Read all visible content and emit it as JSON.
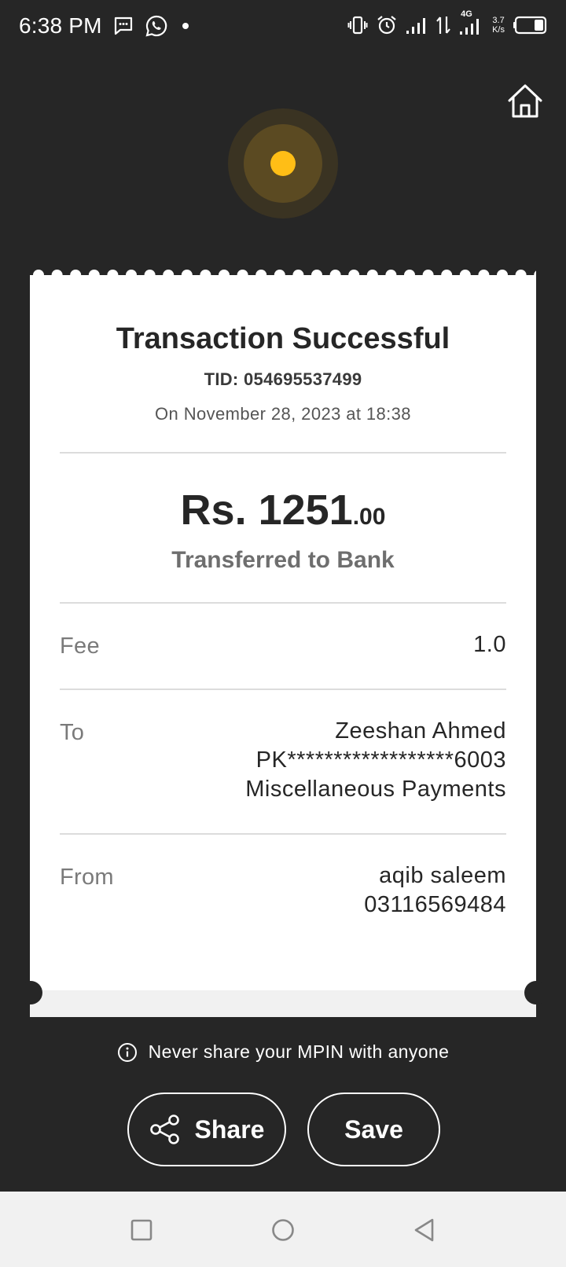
{
  "status_bar": {
    "time": "6:38 PM",
    "network": "4G",
    "speed_value": "3.7",
    "speed_unit": "K/s"
  },
  "icons": {
    "home": "home-icon",
    "info": "info-icon",
    "share": "share-icon",
    "status_indicator_color": "#ffbe16"
  },
  "receipt": {
    "title": "Transaction Successful",
    "tid": "TID: 054695537499",
    "date": "On November 28, 2023 at 18:38",
    "amount_main": "Rs. 1251",
    "amount_decimal": ".00",
    "subtitle": "Transferred to Bank",
    "fee_label": "Fee",
    "fee_value": "1.0",
    "to_label": "To",
    "to_name": "Zeeshan Ahmed",
    "to_account": "PK******************6003",
    "to_purpose": "Miscellaneous Payments",
    "from_label": "From",
    "from_name": "aqib saleem",
    "from_phone": "03116569484"
  },
  "footer": {
    "notice": "Never share your MPIN with anyone",
    "share_label": "Share",
    "save_label": "Save"
  },
  "colors": {
    "background": "#262626",
    "accent": "#ffbe16",
    "card": "#ffffff"
  }
}
